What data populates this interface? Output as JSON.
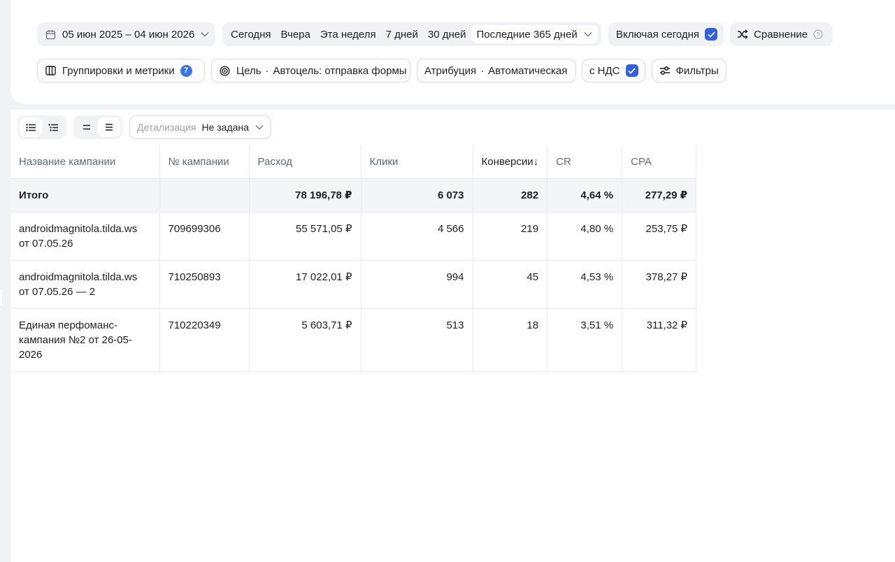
{
  "filters": {
    "date_range": "05 июн 2025 – 04 июн 2026",
    "periods": [
      "Сегодня",
      "Вчера",
      "Эта неделя",
      "7 дней",
      "30 дней"
    ],
    "period_active": "Последние 365 дней",
    "include_today_label": "Включая сегодня",
    "compare_label": "Сравнение",
    "groupings_label": "Группировки и метрики",
    "groupings_count": "7",
    "goal_prefix": "Цель",
    "goal_value": "Автоцель: отправка формы",
    "attribution_prefix": "Атрибуция",
    "attribution_value": "Автоматическая",
    "vat_label": "с НДС",
    "filters_label": "Фильтры"
  },
  "toolbar": {
    "detail_label": "Детализация",
    "detail_value": "Не задана"
  },
  "table": {
    "headers": [
      "Название кампании",
      "№ кампании",
      "Расход",
      "Клики",
      "Конверсии↓",
      "CR",
      "CPA"
    ],
    "total": {
      "name": "Итого",
      "id": "",
      "spend": "78 196,78 ₽",
      "clicks": "6 073",
      "conversions": "282",
      "cr": "4,64 %",
      "cpa": "277,29 ₽"
    },
    "rows": [
      {
        "name_line1": "androidmagnitola.tilda.ws",
        "name_line2": "от 07.05.26",
        "name_line3": "",
        "id": "709699306",
        "spend": "55 571,05 ₽",
        "clicks": "4 566",
        "conversions": "219",
        "cr": "4,80 %",
        "cpa": "253,75 ₽"
      },
      {
        "name_line1": "androidmagnitola.tilda.ws",
        "name_line2": "от 07.05.26 — 2",
        "name_line3": "",
        "id": "710250893",
        "spend": "17 022,01 ₽",
        "clicks": "994",
        "conversions": "45",
        "cr": "4,53 %",
        "cpa": "378,27 ₽"
      },
      {
        "name_line1": "Единая перфоманс-",
        "name_line2": "кампания №2 от 26-05-",
        "name_line3": "2026",
        "id": "710220349",
        "spend": "5 603,71 ₽",
        "clicks": "513",
        "conversions": "18",
        "cr": "3,51 %",
        "cpa": "311,32 ₽"
      }
    ]
  },
  "colors": {
    "accent": "#2f5fe8",
    "badge": "#3a73f0",
    "header_text": "#5d6a7e",
    "page_bg": "#f0f2f6"
  }
}
